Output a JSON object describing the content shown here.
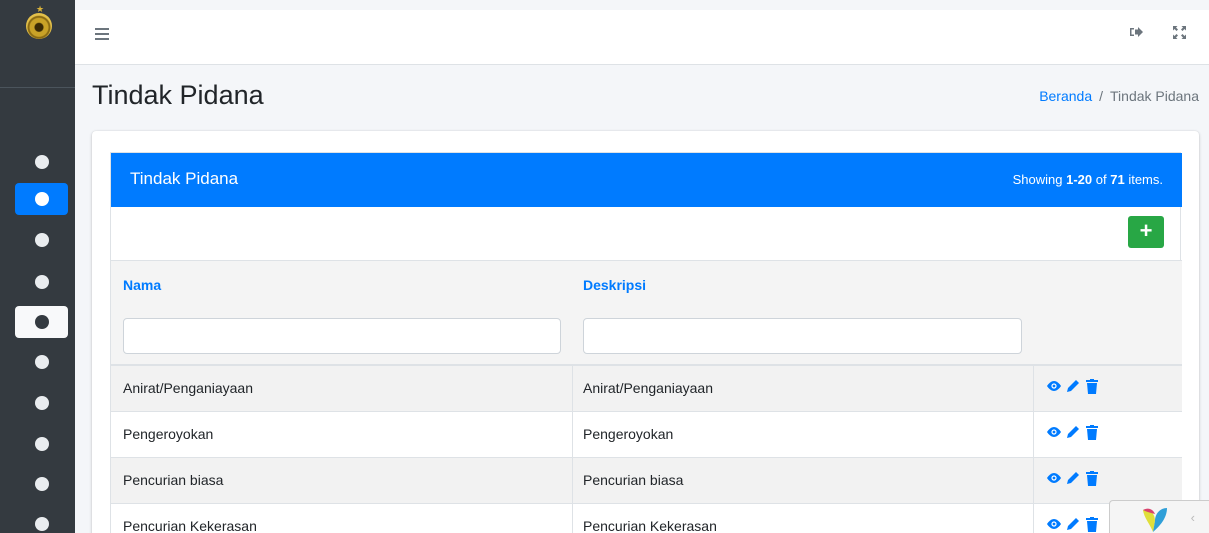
{
  "sidebar": {
    "items": [
      {
        "state": "normal"
      },
      {
        "state": "active"
      },
      {
        "state": "normal"
      },
      {
        "state": "normal"
      },
      {
        "state": "hover"
      },
      {
        "state": "normal"
      },
      {
        "state": "normal"
      },
      {
        "state": "normal"
      },
      {
        "state": "normal"
      },
      {
        "state": "normal"
      }
    ]
  },
  "navbar": {
    "icons": [
      "menu-icon",
      "logout-icon",
      "fullscreen-icon"
    ]
  },
  "header": {
    "title": "Tindak Pidana",
    "breadcrumb": {
      "home": "Beranda",
      "separator": "/",
      "current": "Tindak Pidana"
    }
  },
  "card": {
    "title": "Tindak Pidana",
    "summary": {
      "prefix": "Showing ",
      "range": "1-20",
      "middle": " of ",
      "total": "71",
      "suffix": " items."
    },
    "add_label": "+"
  },
  "table": {
    "columns": [
      "Nama",
      "Deskripsi"
    ],
    "filters": {
      "nama": "",
      "deskripsi": ""
    },
    "rows": [
      {
        "nama": "Anirat/Penganiayaan",
        "deskripsi": "Anirat/Penganiayaan"
      },
      {
        "nama": "Pengeroyokan",
        "deskripsi": "Pengeroyokan"
      },
      {
        "nama": "Pencurian biasa",
        "deskripsi": "Pencurian biasa"
      },
      {
        "nama": "Pencurian Kekerasan",
        "deskripsi": "Pencurian Kekerasan"
      }
    ],
    "action_icons": [
      "eye-icon",
      "pencil-icon",
      "trash-icon"
    ]
  },
  "colors": {
    "primary": "#007bff",
    "success": "#28a745",
    "sidebar": "#343a40"
  }
}
